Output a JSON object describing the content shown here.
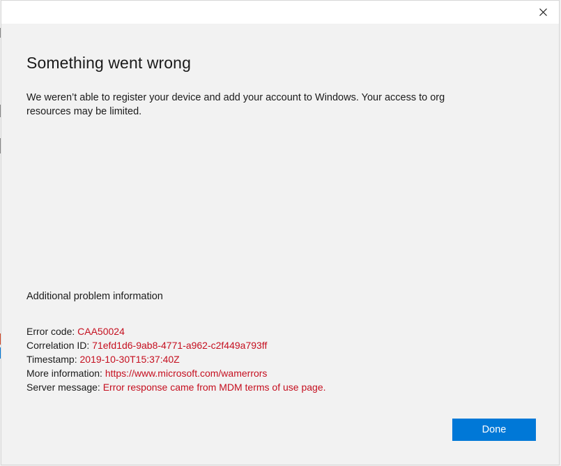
{
  "window": {
    "close_icon": "close-icon"
  },
  "dialog": {
    "title": "Something went wrong",
    "message": "We weren’t able to register your device and add your account to Windows. Your access to org resources may be limited.",
    "section_heading": "Additional problem information",
    "details": [
      {
        "label": "Error code: ",
        "value": "CAA50024"
      },
      {
        "label": "Correlation ID: ",
        "value": "71efd1d6-9ab8-4771-a962-c2f449a793ff"
      },
      {
        "label": "Timestamp: ",
        "value": "2019-10-30T15:37:40Z"
      },
      {
        "label": "More information: ",
        "value": "https://www.microsoft.com/wamerrors"
      },
      {
        "label": "Server message: ",
        "value": "Error response came from MDM terms of use page."
      }
    ],
    "done_label": "Done"
  },
  "colors": {
    "background": "#f2f2f2",
    "titlebar": "#ffffff",
    "accent": "#0078d7",
    "error_value": "#c50f1f",
    "text": "#1a1a1a"
  }
}
